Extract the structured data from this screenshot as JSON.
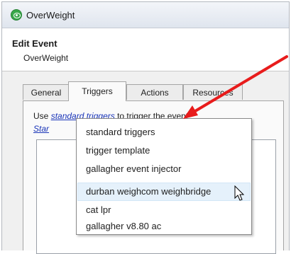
{
  "window": {
    "title": "OverWeight"
  },
  "header": {
    "title": "Edit Event",
    "subtitle": "OverWeight"
  },
  "tabs": [
    {
      "label": "General"
    },
    {
      "label": "Triggers"
    },
    {
      "label": "Actions"
    },
    {
      "label": "Resources"
    }
  ],
  "triggers": {
    "prefix": "Use",
    "link": "standard triggers",
    "suffix": "to trigger the event",
    "second_link": "Star"
  },
  "dropdown": {
    "items": [
      {
        "label": "standard triggers"
      },
      {
        "label": "trigger template"
      },
      {
        "label": "gallagher event injector"
      },
      {
        "label": "durban weighcom weighbridge"
      },
      {
        "label": "cat lpr"
      },
      {
        "label": "gallagher v8.80 ac"
      }
    ],
    "hovered": "durban weighcom weighbridge"
  },
  "annotation": {
    "arrow_color": "#e81c1c"
  }
}
